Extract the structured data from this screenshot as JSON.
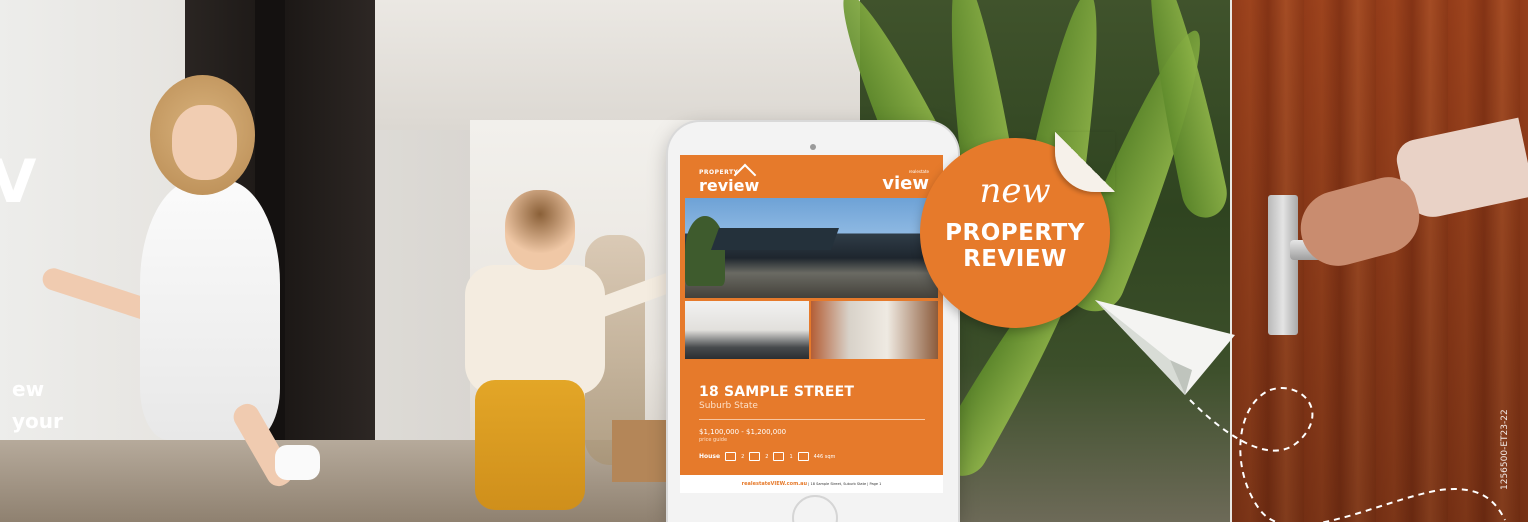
{
  "headline": {
    "big_letter": "V",
    "tag_line_1": "ew",
    "tag_line_2": "your"
  },
  "tablet": {
    "logo_left_small": "PROPERTY",
    "logo_left_main": "review",
    "logo_right_small": "realestate",
    "logo_right_main": "view",
    "property_title": "18 SAMPLE STREET",
    "suburb": "Suburb State",
    "price": "$1,100,000 - $1,200,000",
    "price_label": "price guide",
    "property_type": "House",
    "features": [
      {
        "icon": "bed-icon",
        "value": "2"
      },
      {
        "icon": "bath-icon",
        "value": "2"
      },
      {
        "icon": "car-icon",
        "value": "1"
      },
      {
        "icon": "land-icon",
        "value": "446 sqm"
      }
    ],
    "footer_brand": "realestateVIEW.com.au",
    "footer_text": "| 18 Sample Street, Suburb State | Page 1"
  },
  "sticker": {
    "script_word": "new",
    "line1": "PROPERTY",
    "line2": "REVIEW"
  },
  "tracking_code": "1256500-ET23-22",
  "colors": {
    "brand_orange": "#e67a2b",
    "white": "#ffffff"
  }
}
